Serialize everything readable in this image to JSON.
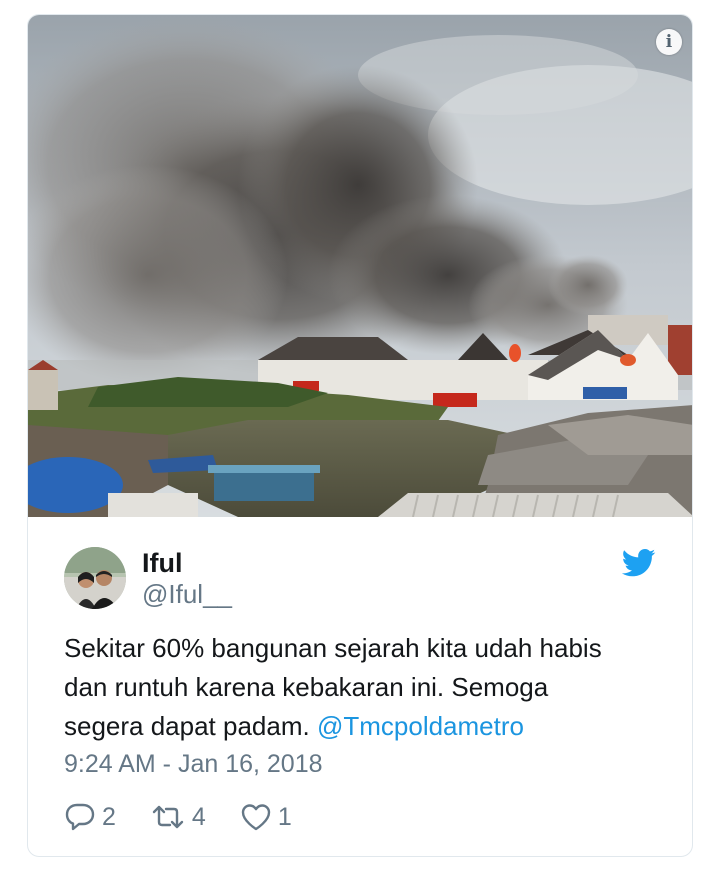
{
  "media": {
    "image_icon": "fire-smoke-photo",
    "info_icon": "info-icon",
    "info_glyph": "i"
  },
  "author": {
    "display_name": "Iful",
    "handle": "@Iful__",
    "avatar_icon": "avatar-photo"
  },
  "brand": {
    "icon": "twitter-bird-icon",
    "color": "#1da1f2"
  },
  "tweet": {
    "text_line1": "Sekitar 60% bangunan sejarah kita udah habis",
    "text_line2": "dan runtuh karena kebakaran ini. Semoga",
    "text_line3": "segera dapat padam. ",
    "mention": "@Tmcpoldametro",
    "timestamp": "9:24 AM - Jan 16, 2018"
  },
  "actions": {
    "reply_count": "2",
    "retweet_count": "4",
    "like_count": "1"
  },
  "colors": {
    "text": "#14171a",
    "secondary": "#657786",
    "link": "#1b95e0",
    "border": "#e1e8ed"
  }
}
